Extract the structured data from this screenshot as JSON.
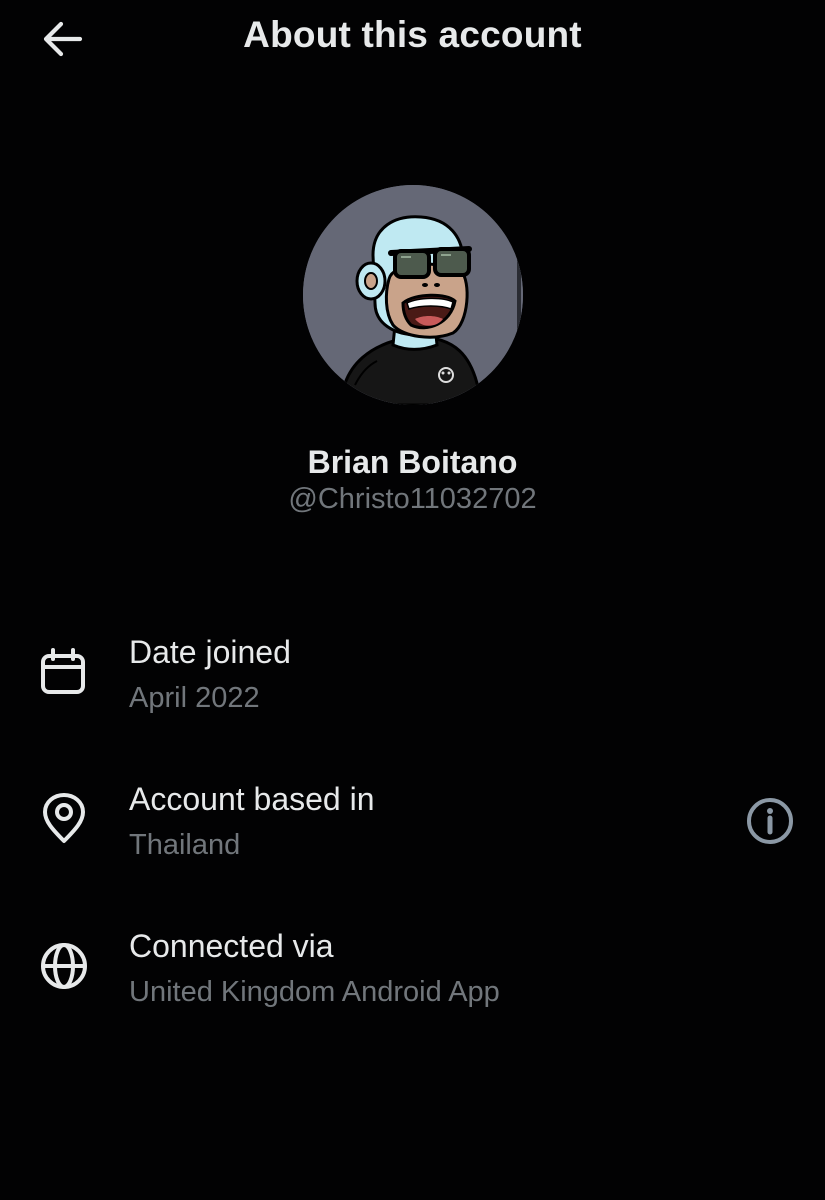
{
  "header": {
    "title": "About this account",
    "back_icon": "arrow-left-icon"
  },
  "profile": {
    "display_name": "Brian Boitano",
    "handle": "@Christo11032702",
    "avatar_bg": "#656876"
  },
  "details": [
    {
      "icon": "calendar-icon",
      "title": "Date joined",
      "value": "April 2022"
    },
    {
      "icon": "location-pin-icon",
      "title": "Account based in",
      "value": "Thailand",
      "info_icon": "info-icon"
    },
    {
      "icon": "globe-icon",
      "title": "Connected via",
      "value": "United Kingdom Android App"
    }
  ],
  "colors": {
    "background": "#020203",
    "primary_text": "#e7e9ea",
    "secondary_text": "#71767b"
  }
}
